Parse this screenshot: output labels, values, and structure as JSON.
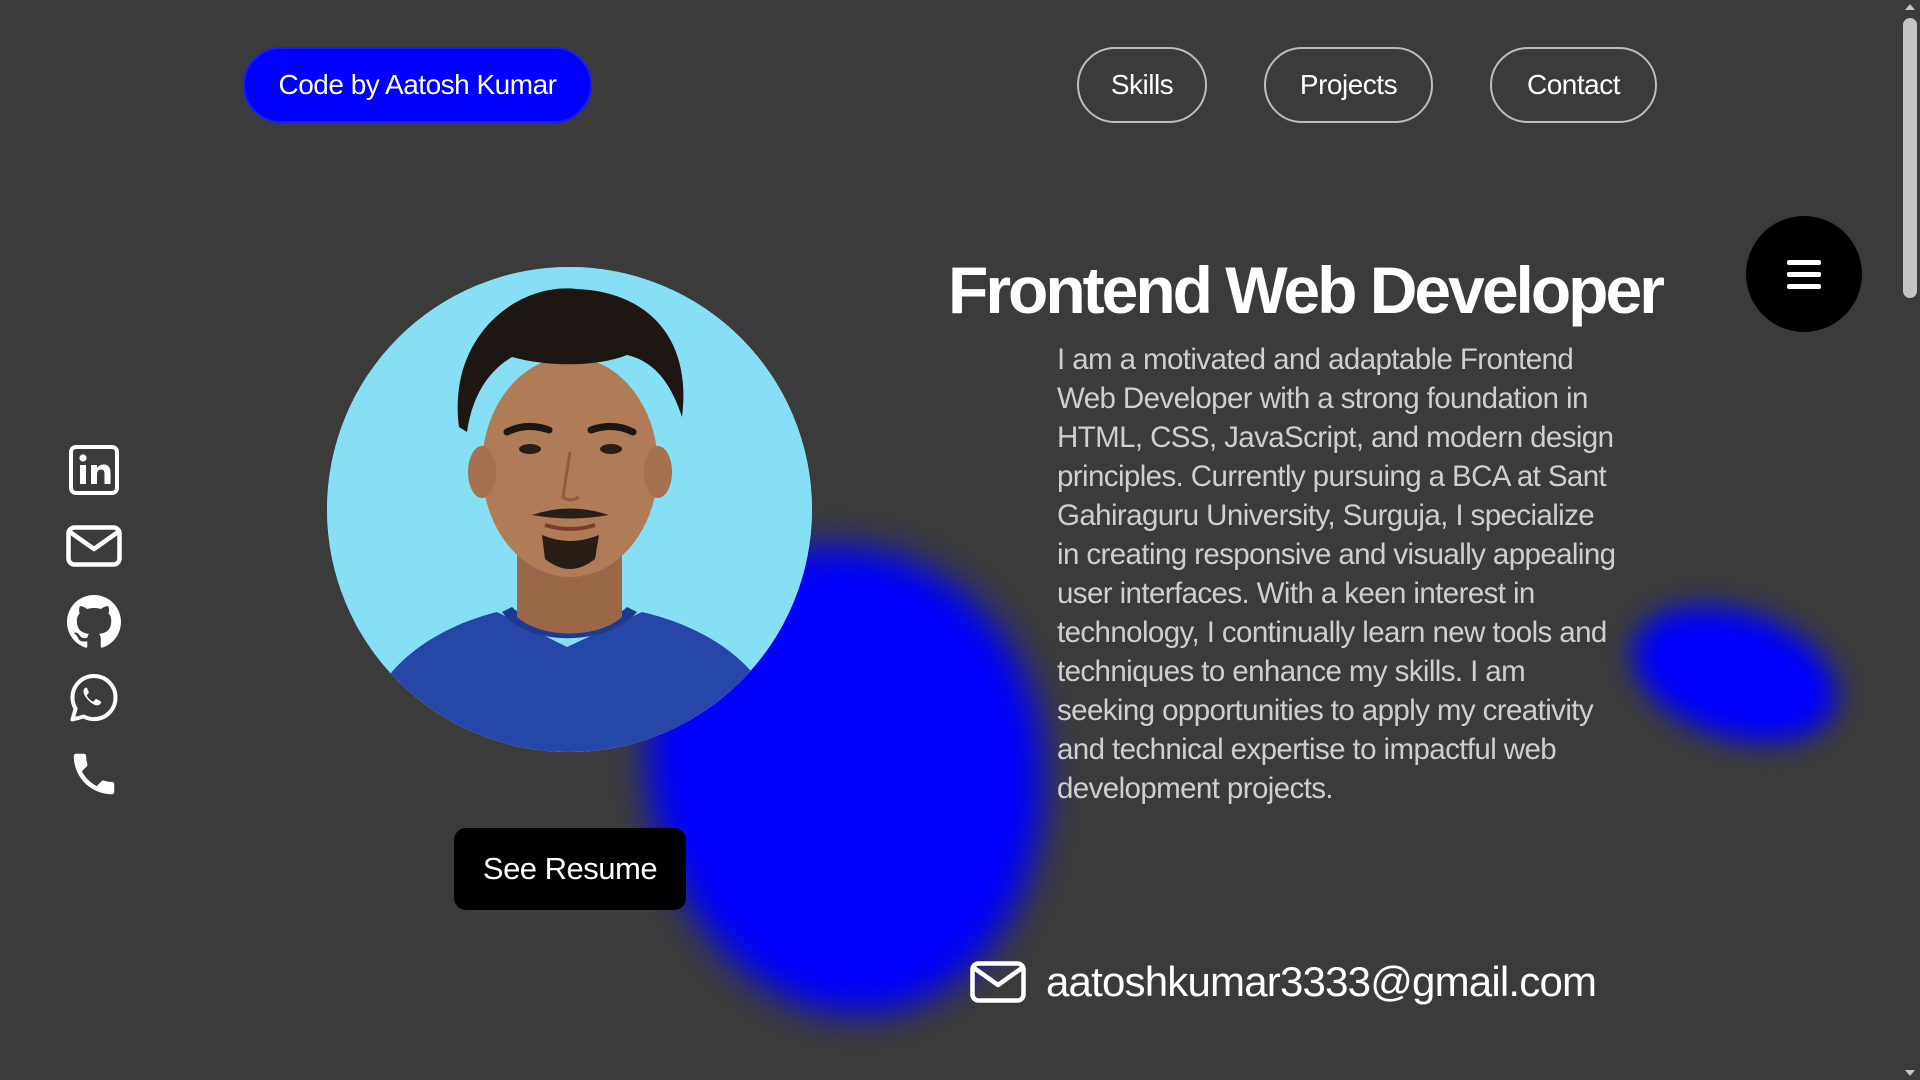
{
  "nav": {
    "brand_label": "Code by Aatosh Kumar",
    "links": [
      "Skills",
      "Projects",
      "Contact"
    ]
  },
  "menu": {
    "icon": "hamburger-icon"
  },
  "social": [
    {
      "name": "linkedin",
      "icon": "linkedin-icon"
    },
    {
      "name": "email",
      "icon": "mail-icon"
    },
    {
      "name": "github",
      "icon": "github-icon"
    },
    {
      "name": "whatsapp",
      "icon": "whatsapp-icon"
    },
    {
      "name": "phone",
      "icon": "phone-icon"
    }
  ],
  "hero": {
    "title": "Frontend Web Developer",
    "description": "I am a motivated and adaptable Frontend Web Developer with a strong foundation in HTML, CSS, JavaScript, and modern design principles. Currently pursuing a BCA at Sant Gahiraguru University, Surguja, I specialize in creating responsive and visually appealing user interfaces. With a keen interest in technology, I continually learn new tools and techniques to enhance my skills. I am seeking opportunities to apply my creativity and technical expertise to impactful web development projects.",
    "resume_label": "See Resume",
    "email": "aatoshkumar3333@gmail.com"
  },
  "colors": {
    "background": "#3b3b3b",
    "accent": "#0000ff",
    "button_dark": "#000000",
    "avatar_bg": "#86dff5"
  }
}
